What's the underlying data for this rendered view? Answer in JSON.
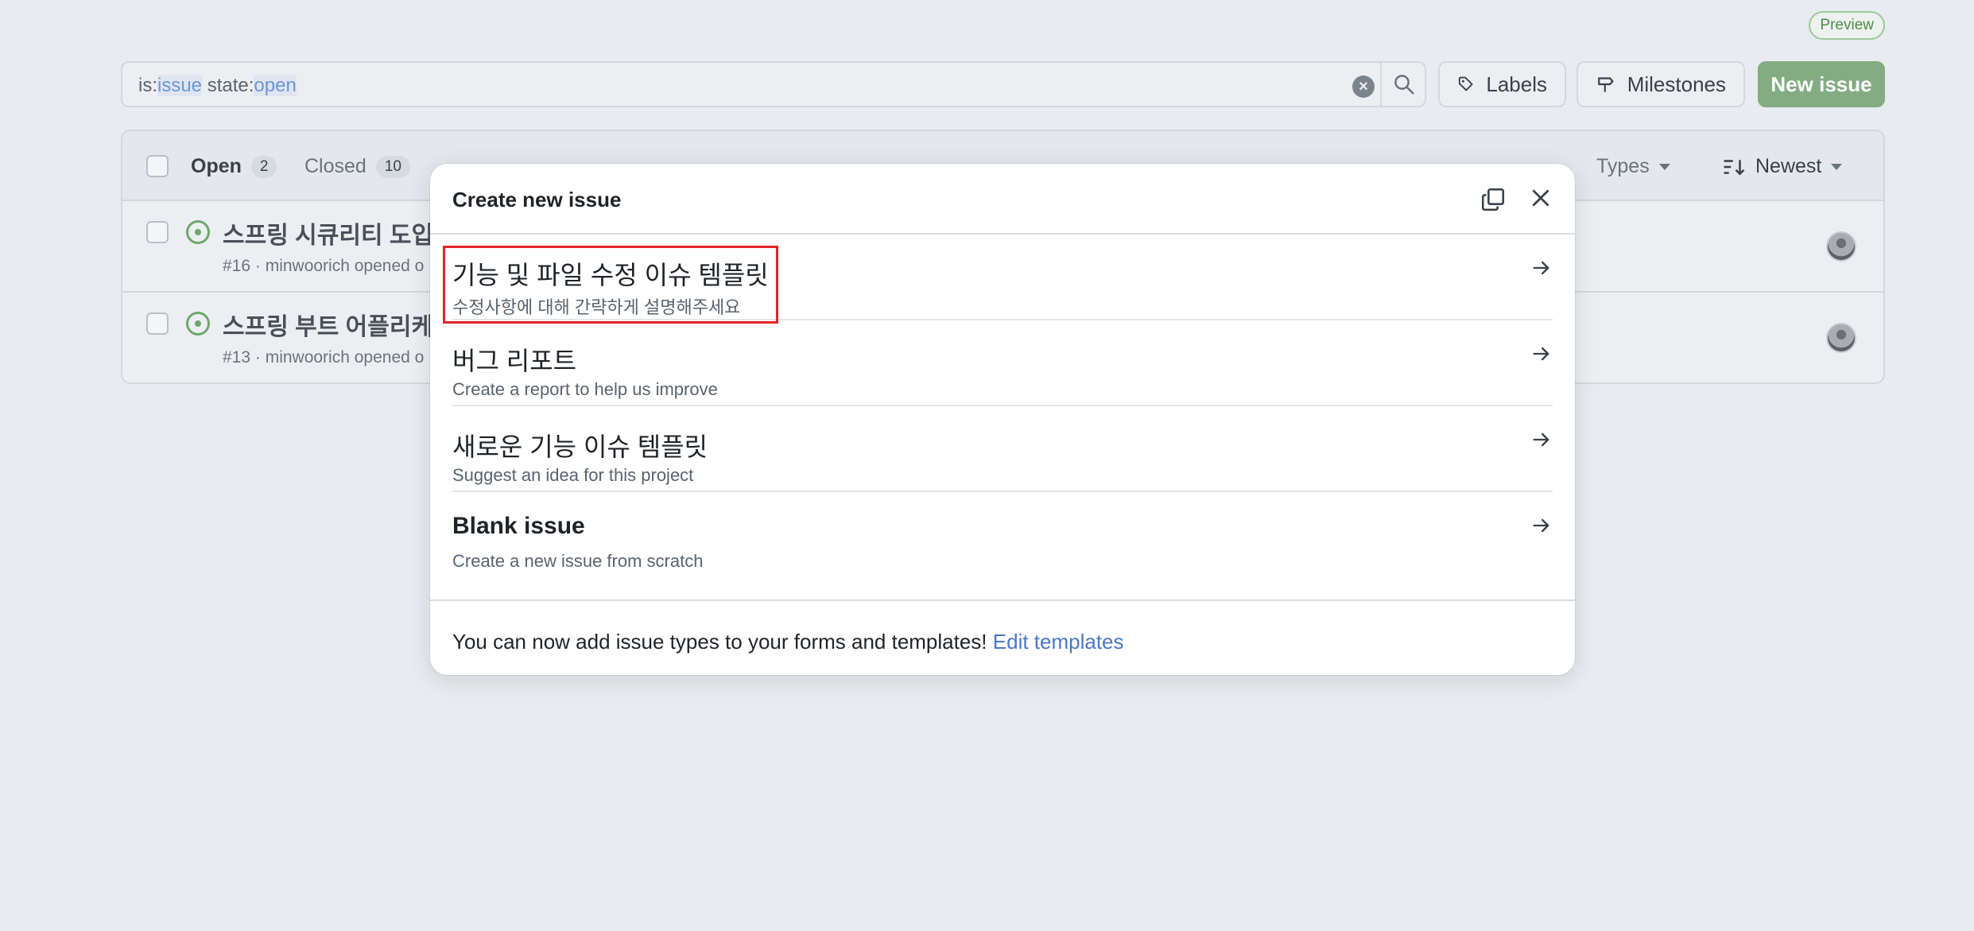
{
  "preview_badge": "Preview",
  "search": {
    "prefix1": "is:",
    "keyword1": "issue",
    "prefix2": " state:",
    "keyword2": "open"
  },
  "toolbar": {
    "labels": "Labels",
    "milestones": "Milestones",
    "new_issue": "New issue"
  },
  "issues": {
    "tabs": {
      "open_label": "Open",
      "open_count": "2",
      "closed_label": "Closed",
      "closed_count": "10"
    },
    "filters": {
      "types": "Types",
      "sort": "Newest"
    },
    "rows": [
      {
        "title": "스프링 시큐리티 도입",
        "meta": "#16 · minwoorich opened o"
      },
      {
        "title": "스프링 부트 어플리케",
        "meta": "#13 · minwoorich opened o"
      }
    ]
  },
  "modal": {
    "title": "Create new issue",
    "templates": [
      {
        "name": "기능 및 파일 수정 이슈 템플릿",
        "description": "수정사항에 대해 간략하게 설명해주세요"
      },
      {
        "name": "버그 리포트",
        "description": "Create a report to help us improve"
      },
      {
        "name": "새로운 기능 이슈 템플릿",
        "description": "Suggest an idea for this project"
      },
      {
        "name": "Blank issue",
        "description": "Create a new issue from scratch"
      }
    ],
    "footer": {
      "text": "You can now add issue types to your forms and templates! ",
      "link": "Edit templates"
    }
  },
  "colors": {
    "primary_button": "#84ac83",
    "link": "#4a78c2",
    "highlight": "#e3242b"
  }
}
